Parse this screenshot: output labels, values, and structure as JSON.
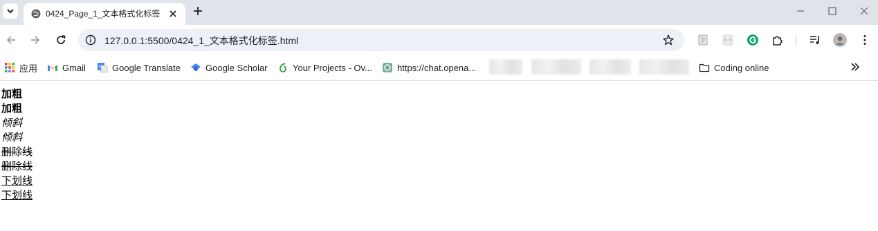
{
  "tab": {
    "title": "0424_Page_1_文本格式化标签"
  },
  "address_bar": {
    "url": "127.0.0.1:5500/0424_1_文本格式化标签.html"
  },
  "bookmarks": [
    {
      "label": "应用",
      "icon": "apps-grid-icon"
    },
    {
      "label": "Gmail",
      "icon": "gmail-icon"
    },
    {
      "label": "Google Translate",
      "icon": "google-translate-icon"
    },
    {
      "label": "Google Scholar",
      "icon": "google-scholar-icon"
    },
    {
      "label": "Your Projects - Ov...",
      "icon": "overleaf-icon"
    },
    {
      "label": "https://chat.opena...",
      "icon": "openai-icon"
    },
    {
      "label": "Coding online",
      "icon": "folder-icon"
    }
  ],
  "page": {
    "lines": [
      {
        "text": "加粗",
        "style": "bold"
      },
      {
        "text": "加粗",
        "style": "bold"
      },
      {
        "text": "倾斜",
        "style": "italic"
      },
      {
        "text": "倾斜",
        "style": "italic"
      },
      {
        "text": "删除线",
        "style": "strikethrough"
      },
      {
        "text": "删除线",
        "style": "strikethrough"
      },
      {
        "text": "下划线",
        "style": "underline"
      },
      {
        "text": "下划线",
        "style": "underline"
      }
    ]
  },
  "colors": {
    "tabstrip_bg": "#dfe3ea",
    "omnibox_bg": "#edf0f6",
    "accent_blue": "#1a73e8"
  }
}
